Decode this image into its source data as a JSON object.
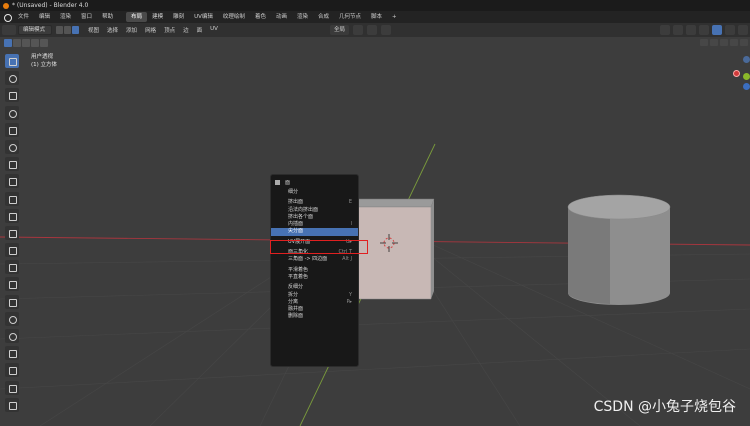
{
  "window": {
    "title": "* (Unsaved) - Blender 4.0"
  },
  "top_menu": [
    "文件",
    "编辑",
    "渲染",
    "窗口",
    "帮助"
  ],
  "workspace_tabs": [
    {
      "label": "布局",
      "active": true
    },
    {
      "label": "建模"
    },
    {
      "label": "雕刻"
    },
    {
      "label": "UV编辑"
    },
    {
      "label": "纹理绘制"
    },
    {
      "label": "着色"
    },
    {
      "label": "动画"
    },
    {
      "label": "渲染"
    },
    {
      "label": "合成"
    },
    {
      "label": "几何节点"
    },
    {
      "label": "脚本"
    }
  ],
  "add_tab": "+",
  "header": {
    "mode": "编辑模式",
    "view_menu": [
      "视图",
      "选择",
      "添加",
      "网格",
      "顶点",
      "边",
      "面",
      "UV"
    ],
    "transform": "全局"
  },
  "viewport": {
    "view_name": "用户透视",
    "object_name": "(1) 立方体"
  },
  "context_menu": {
    "title": "面",
    "items": [
      {
        "label": "细分",
        "shortcut": ""
      },
      {
        "sep": true
      },
      {
        "label": "挤出面",
        "shortcut": "E"
      },
      {
        "label": "沿法向挤出面",
        "shortcut": ""
      },
      {
        "label": "挤出各个面",
        "shortcut": ""
      },
      {
        "label": "内插面",
        "shortcut": "I"
      },
      {
        "label": "尖分面",
        "shortcut": "",
        "highlighted": true
      },
      {
        "sep": true
      },
      {
        "label": "UV展开面",
        "shortcut": "U▸"
      },
      {
        "sep": true
      },
      {
        "label": "面三角化",
        "shortcut": "Ctrl T"
      },
      {
        "label": "三角面 -> 四边面",
        "shortcut": "Alt J"
      },
      {
        "sep": true
      },
      {
        "label": "平滑着色",
        "shortcut": ""
      },
      {
        "label": "平直着色",
        "shortcut": ""
      },
      {
        "sep": true
      },
      {
        "label": "反细分",
        "shortcut": ""
      },
      {
        "label": "拆分",
        "shortcut": "Y"
      },
      {
        "label": "分离",
        "shortcut": "P▸"
      },
      {
        "label": "融并面",
        "shortcut": ""
      },
      {
        "label": "删除面",
        "shortcut": ""
      }
    ]
  },
  "watermark": "CSDN @小兔子烧包谷",
  "colors": {
    "accent": "#4772b3",
    "highlight_box": "#e02020",
    "x_axis": "#a8363e",
    "y_axis": "#7a9b3c"
  }
}
